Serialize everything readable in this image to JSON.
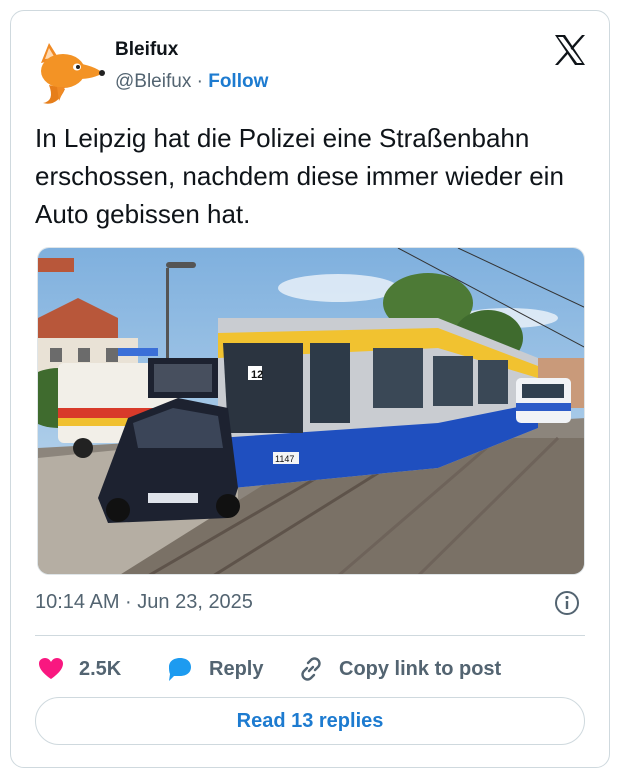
{
  "author": {
    "name": "Bleifux",
    "handle": "@Bleifux",
    "separator": " · ",
    "follow_label": "Follow"
  },
  "tweet": {
    "text": "In Leipzig hat die Polizei eine Straßenbahn erschossen, nachdem diese immer wieder ein Auto gebissen hat.",
    "timestamp": "10:14 AM · Jun 23, 2025"
  },
  "media": {
    "tram_number": "1147",
    "route_number": "12"
  },
  "actions": {
    "likes_count": "2.5K",
    "reply_label": "Reply",
    "copy_link_label": "Copy link to post"
  },
  "replies_button": {
    "label": "Read 13 replies"
  },
  "colors": {
    "accent": "#1d7bd0",
    "like": "#f91880",
    "reply_icon": "#1d9bf0",
    "muted": "#536471"
  }
}
